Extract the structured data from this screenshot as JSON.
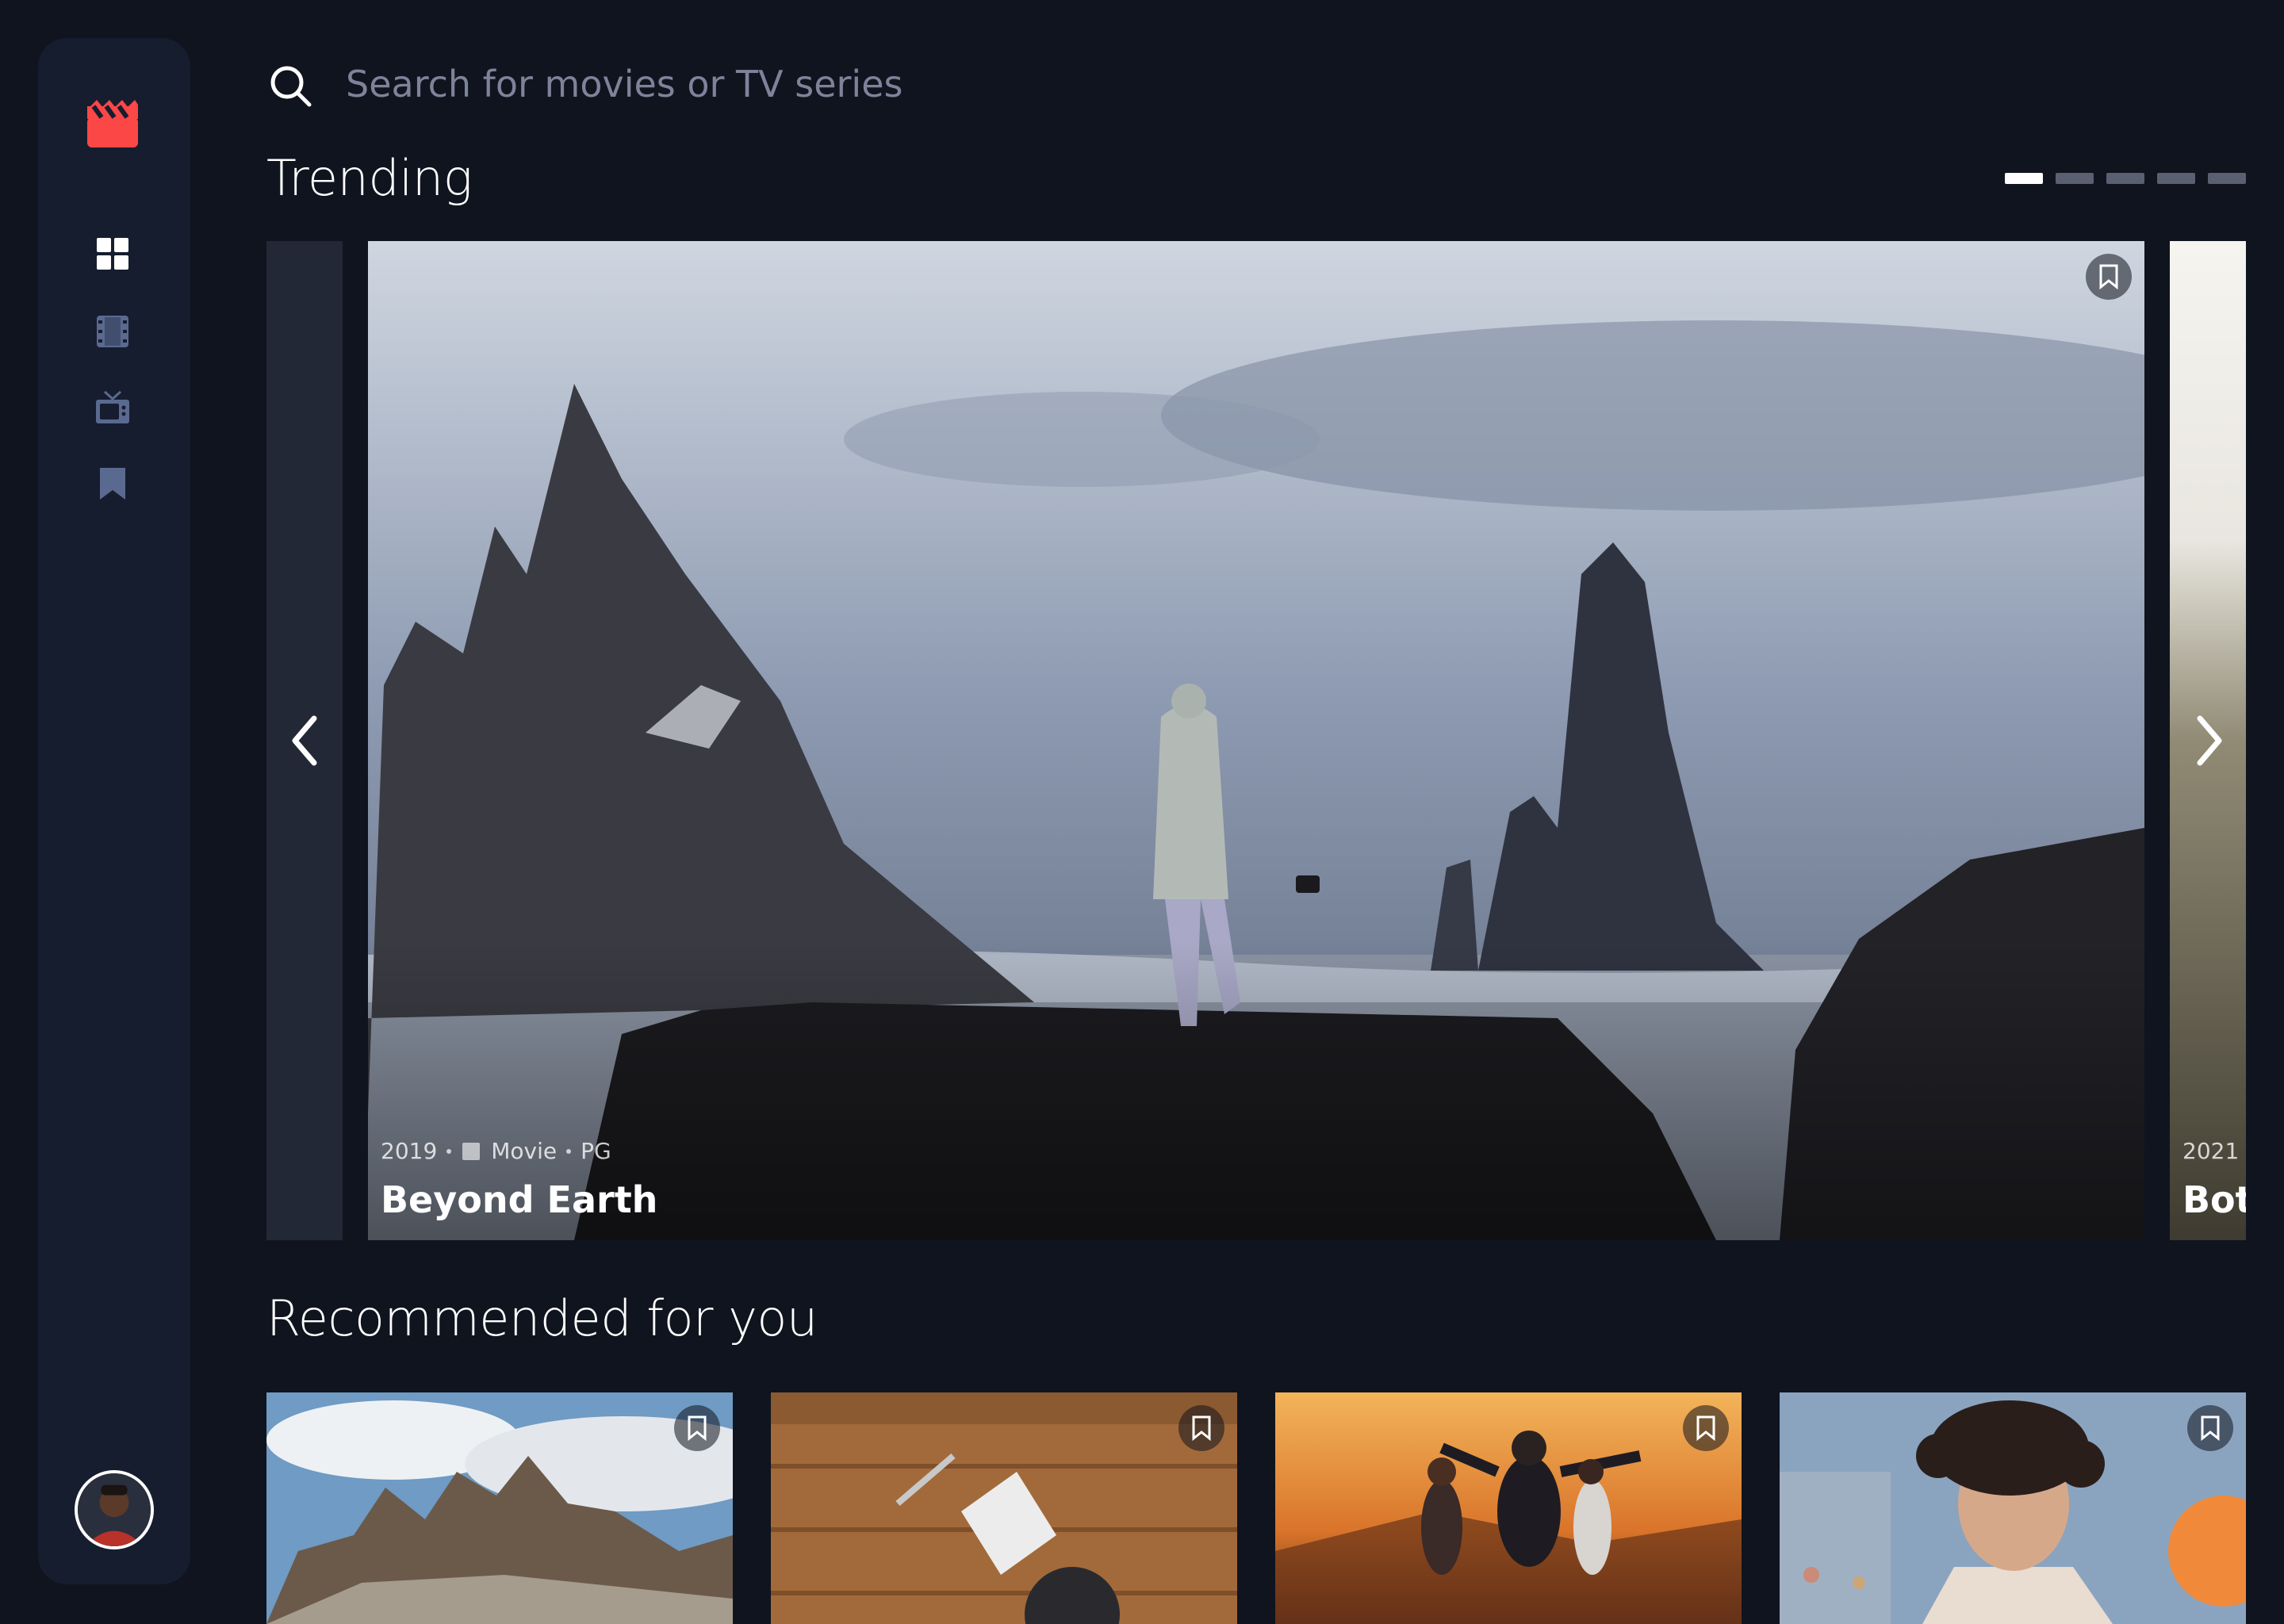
{
  "search": {
    "placeholder": "Search for movies or TV series"
  },
  "nav": {
    "icons": [
      "logo-icon",
      "home-grid-icon",
      "movie-film-icon",
      "tv-icon",
      "bookmark-icon"
    ],
    "active": "home"
  },
  "colors": {
    "background": "#10141e",
    "sidebar": "#161d2f",
    "accent_red": "#fc4747",
    "muted": "#5a698f",
    "white": "#ffffff"
  },
  "trending": {
    "title": "Trending",
    "pagination_count": 5,
    "active_page": 1,
    "items": [
      {
        "year": "2019",
        "category": "Movie",
        "rating": "PG",
        "title": "Beyond Earth"
      },
      {
        "year": "2021",
        "title": "Bot"
      }
    ]
  },
  "recommended": {
    "title": "Recommended for you"
  }
}
